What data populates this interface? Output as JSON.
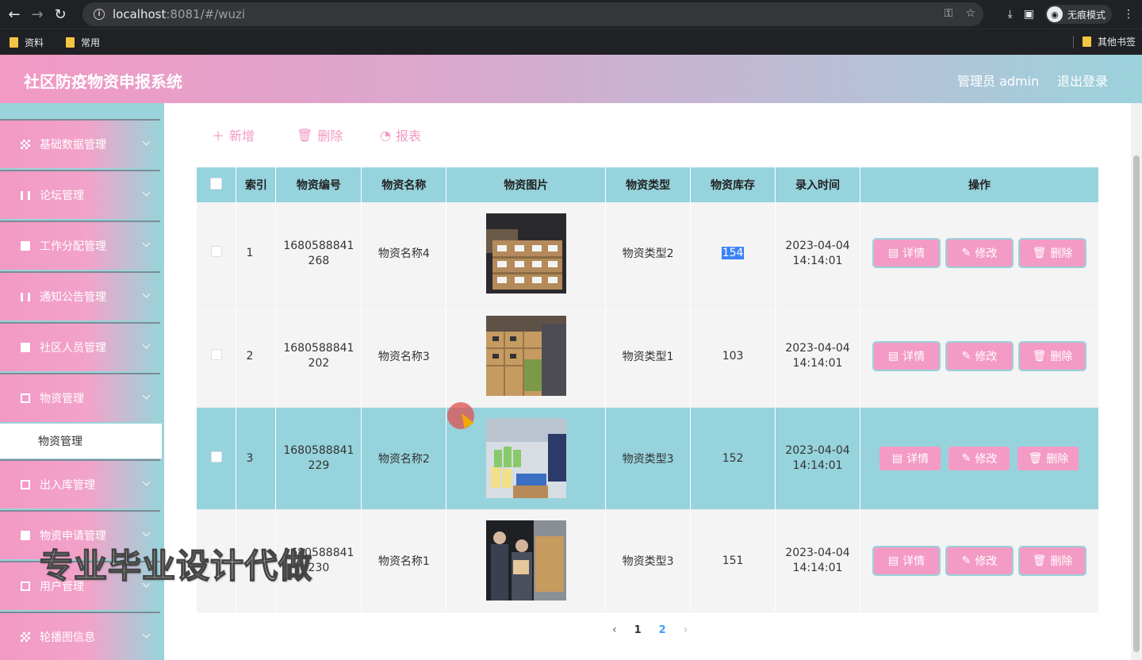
{
  "browser": {
    "url_host": "localhost",
    "url_rest": ":8081/#/wuzi",
    "incognito_label": "无痕模式",
    "bookmarks": [
      "资料",
      "常用"
    ],
    "other_bookmarks": "其他书签"
  },
  "header": {
    "title": "社区防疫物资申报系统",
    "user": "管理员 admin",
    "logout": "退出登录"
  },
  "sidebar": {
    "items": [
      {
        "label": "基础数据管理",
        "icon": "grid-icon"
      },
      {
        "label": "论坛管理",
        "icon": "sliders-icon"
      },
      {
        "label": "工作分配管理",
        "icon": "monitor-icon"
      },
      {
        "label": "通知公告管理",
        "icon": "bar-chart-icon"
      },
      {
        "label": "社区人员管理",
        "icon": "people-icon"
      },
      {
        "label": "物资管理",
        "icon": "box-icon"
      },
      {
        "label": "出入库管理",
        "icon": "clipboard-icon"
      },
      {
        "label": "物资申请管理",
        "icon": "chart-icon"
      },
      {
        "label": "用户管理",
        "icon": "user-icon"
      },
      {
        "label": "轮播图信息",
        "icon": "grid-icon"
      }
    ],
    "active_sub": "物资管理"
  },
  "toolbar": {
    "add": "新增",
    "delete": "删除",
    "report": "报表"
  },
  "table": {
    "headers": [
      "索引",
      "物资编号",
      "物资名称",
      "物资图片",
      "物资类型",
      "物资库存",
      "录入时间",
      "操作"
    ],
    "rows": [
      {
        "index": "1",
        "code_a": "1680588841",
        "code_b": "268",
        "name": "物资名称4",
        "type": "物资类型2",
        "stock": "154",
        "date": "2023-04-04",
        "time": "14:14:01"
      },
      {
        "index": "2",
        "code_a": "1680588841",
        "code_b": "202",
        "name": "物资名称3",
        "type": "物资类型1",
        "stock": "103",
        "date": "2023-04-04",
        "time": "14:14:01"
      },
      {
        "index": "3",
        "code_a": "1680588841",
        "code_b": "229",
        "name": "物资名称2",
        "type": "物资类型3",
        "stock": "152",
        "date": "2023-04-04",
        "time": "14:14:01"
      },
      {
        "index": "4",
        "code_a": "1680588841",
        "code_b": "230",
        "name": "物资名称1",
        "type": "物资类型3",
        "stock": "151",
        "date": "2023-04-04",
        "time": "14:14:01"
      }
    ],
    "actions": {
      "detail": "详情",
      "edit": "修改",
      "delete": "删除"
    }
  },
  "pager": {
    "pages": [
      "1",
      "2"
    ],
    "current": "2"
  },
  "watermark": "专业毕业设计代做",
  "colors": {
    "accent_pink": "#f299c4",
    "accent_teal": "#96d3dc"
  }
}
